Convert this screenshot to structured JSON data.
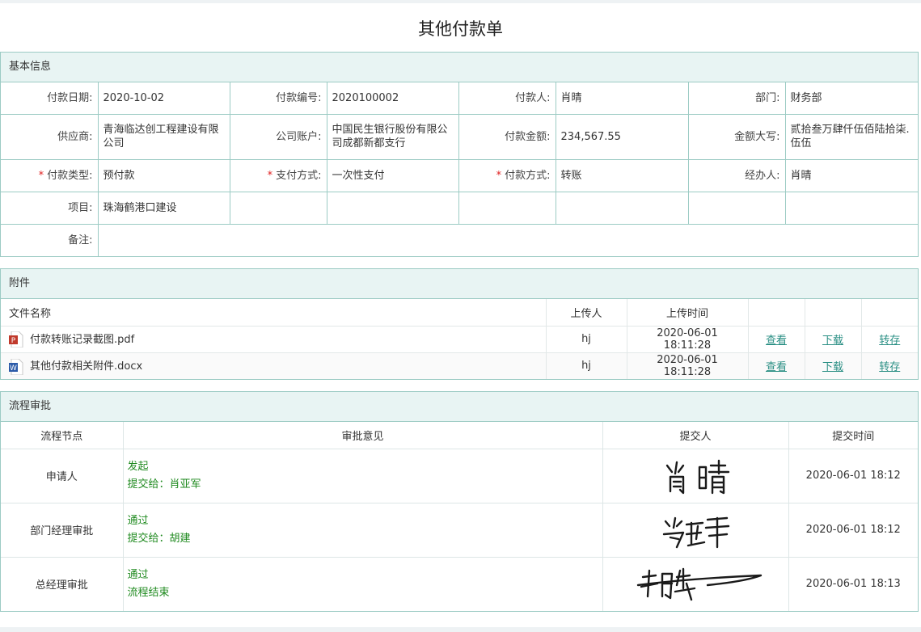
{
  "title": "其他付款单",
  "basic": {
    "heading": "基本信息",
    "labels": {
      "pay_date": "付款日期:",
      "pay_no": "付款编号:",
      "payer": "付款人:",
      "dept": "部门:",
      "supplier": "供应商:",
      "account": "公司账户:",
      "amount": "付款金额:",
      "amount_cn": "金额大写:",
      "pay_type": "付款类型:",
      "pay_method": "支付方式:",
      "pay_way": "付款方式:",
      "handler": "经办人:",
      "project": "项目:",
      "remark": "备注:"
    },
    "values": {
      "pay_date": "2020-10-02",
      "pay_no": "2020100002",
      "payer": "肖晴",
      "dept": "财务部",
      "supplier": "青海临达创工程建设有限公司",
      "account": "中国民生银行股份有限公司成都新都支行",
      "amount": "234,567.55",
      "amount_cn": "贰拾叁万肆仟伍佰陆拾柒.伍伍",
      "pay_type": "预付款",
      "pay_method": "一次性支付",
      "pay_way": "转账",
      "handler": "肖晴",
      "project": "珠海鹤港口建设",
      "remark": ""
    },
    "required_mark": "*"
  },
  "attachments": {
    "heading": "附件",
    "columns": [
      "文件名称",
      "上传人",
      "上传时间"
    ],
    "files": [
      {
        "icon": "pdf-file-icon",
        "name": "付款转账记录截图.pdf",
        "uploader": "hj",
        "time": "2020-06-01 18:11:28",
        "view": "查看",
        "download": "下载",
        "save": "转存"
      },
      {
        "icon": "word-file-icon",
        "name": "其他付款相关附件.docx",
        "uploader": "hj",
        "time": "2020-06-01 18:11:28",
        "view": "查看",
        "download": "下载",
        "save": "转存"
      }
    ]
  },
  "flow": {
    "heading": "流程审批",
    "columns": [
      "流程节点",
      "审批意见",
      "提交人",
      "提交时间"
    ],
    "rows": [
      {
        "node": "申请人",
        "opinion": "发起",
        "next": "提交给：肖亚军",
        "signature": "肖晴",
        "time": "2020-06-01 18:12"
      },
      {
        "node": "部门经理审批",
        "opinion": "通过",
        "next": "提交给：胡建",
        "signature": "肖亚军",
        "time": "2020-06-01 18:12"
      },
      {
        "node": "总经理审批",
        "opinion": "通过",
        "next": "流程结束",
        "signature": "胡建",
        "time": "2020-06-01 18:13"
      }
    ]
  },
  "colors": {
    "border": "#9ccbc4",
    "header_bg": "#e8f4f3",
    "link": "#2a8f84",
    "approve_text": "#1f8a1f",
    "required": "#e02020"
  }
}
